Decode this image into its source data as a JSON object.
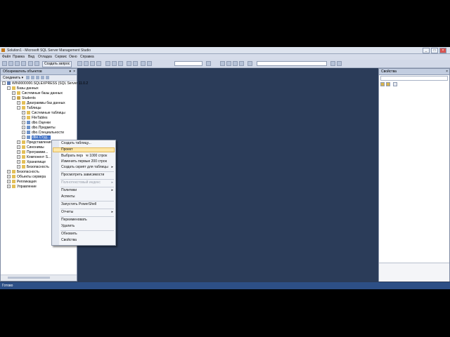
{
  "window": {
    "title": "Solution1 - Microsoft SQL Server Management Studio"
  },
  "menu": [
    "Файл",
    "Правка",
    "Вид",
    "Отладка",
    "Сервис",
    "Окно",
    "Справка"
  ],
  "toolbar": {
    "new_query_label": "Создать запрос"
  },
  "object_explorer": {
    "title": "Обозреватель объектов",
    "connect_label": "Соединить ▾",
    "tree": {
      "server": "WIN0000000.SQLEXPRESS (SQL Server 11.0.2",
      "databases": "Базы данных",
      "system_databases": "Системные базы данных",
      "students_db": "Students",
      "diagrams": "Диаграммы баз данных",
      "tables": "Таблицы",
      "system_tables": "Системные таблицы",
      "filetables": "FileTables",
      "table1": "dbo.Оценки",
      "table2": "dbo.Предметы",
      "table3": "dbo.Специальности",
      "table4": "dbo.Студ...",
      "views": "Представления",
      "synonyms": "Синонимы",
      "programmability": "Программи...",
      "service_broker": "Компонент S...",
      "storage": "Хранилище",
      "db_security": "Безопасность",
      "security": "Безопасность",
      "server_objects": "Объекты сервера",
      "replication": "Репликация",
      "management": "Управление"
    }
  },
  "context_menu": {
    "items": {
      "new_table": "Создать таблицу...",
      "design": "Проект",
      "select_top": "Выбрать первые 1000 строк",
      "edit_top": "Изменить первые 200 строк",
      "script_table": "Создать скрипт для таблицы",
      "view_deps": "Просмотреть зависимости",
      "fulltext_index": "Полнотекстовый индекс",
      "policies": "Политики",
      "facets": "Аспекты",
      "powershell": "Запустить PowerShell",
      "reports": "Отчеты",
      "rename": "Переименовать",
      "delete": "Удалить",
      "refresh": "Обновить",
      "properties": "Свойства"
    }
  },
  "properties": {
    "title": "Свойства"
  },
  "status": {
    "text": "Готово"
  }
}
